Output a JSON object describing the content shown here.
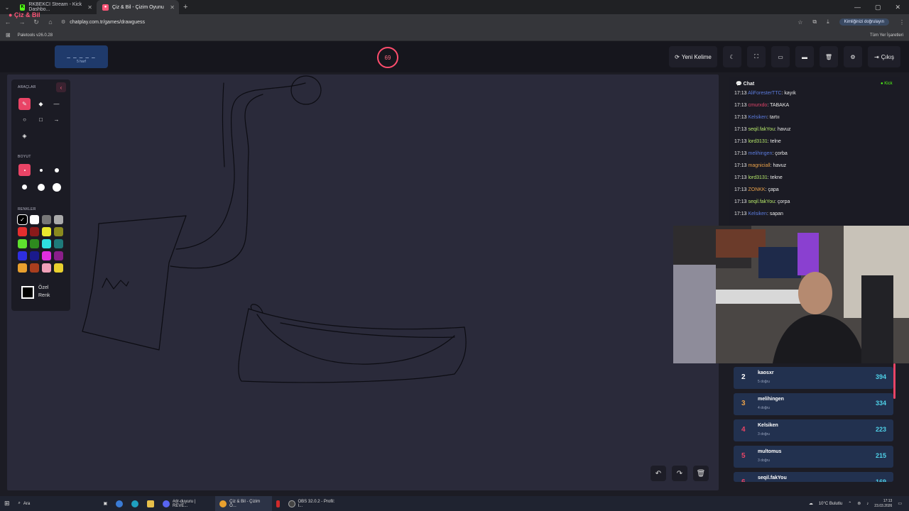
{
  "browser": {
    "tabs": [
      {
        "title": "RKBEKCI Stream - Kick Dashbo...",
        "icon": "kick-logo-icon",
        "color": "#53fc18"
      },
      {
        "title": "Çiz & Bil - Çizim Oyunu",
        "icon": "palette-icon",
        "color": "#ff5577"
      }
    ],
    "url": "chatplay.com.tr/games/drawguess",
    "verify_label": "Kimliğinizi doğrulayın",
    "bookmark": "Paletools v26.0.28",
    "all_bookmarks": "Tüm Yer İşaretleri"
  },
  "header": {
    "logo": "Çiz & Bil",
    "word_blanks": "_ _ _ _ _",
    "word_hint": "5 harf",
    "timer": "69",
    "new_word": "Yeni Kelime",
    "exit": "Çıkış"
  },
  "tools": {
    "section_tools": "ARAÇLAR",
    "section_size": "BOYUT",
    "section_colors": "RENKLER",
    "custom_color_line1": "Özel",
    "custom_color_line2": "Renk",
    "swatches": [
      "#000000",
      "#ffffff",
      "#777777",
      "#aaaaaa",
      "#e52e2e",
      "#8b1a1a",
      "#e8e82e",
      "#8a8a1e",
      "#5ee02e",
      "#2e8a1e",
      "#2ee0e0",
      "#1e7a7a",
      "#2e2ee0",
      "#1a1a8b",
      "#e02ee0",
      "#8a1e8a",
      "#e8a02e",
      "#a83e1e",
      "#f0a0b8",
      "#e8d02e"
    ]
  },
  "chat": {
    "title": "Chat",
    "source": "Kick",
    "messages": [
      {
        "time": "17:13",
        "user": "AliForesterTTC",
        "text": ": kayık",
        "color": "#5b7bdc"
      },
      {
        "time": "17:13",
        "user": "cmurxdo",
        "text": ": TABAKA",
        "color": "#e0446a"
      },
      {
        "time": "17:13",
        "user": "Kelsiken",
        "text": ": tartıı",
        "color": "#5b7bdc"
      },
      {
        "time": "17:13",
        "user": "seqil.fakYou",
        "text": ": havuz",
        "color": "#b6e86a"
      },
      {
        "time": "17:13",
        "user": "lord3131",
        "text": ": telne",
        "color": "#b6e86a"
      },
      {
        "time": "17:13",
        "user": "melihingen",
        "text": ": çorba",
        "color": "#5b7bdc"
      },
      {
        "time": "17:13",
        "user": "magniciall",
        "text": ": havuz",
        "color": "#e8a04a"
      },
      {
        "time": "17:13",
        "user": "lord3131",
        "text": ": tekne",
        "color": "#b6e86a"
      },
      {
        "time": "17:13",
        "user": "ZONKK",
        "text": ": çapa",
        "color": "#e8a04a"
      },
      {
        "time": "17:13",
        "user": "seqil.fakYou",
        "text": ": çorpa",
        "color": "#b6e86a"
      },
      {
        "time": "17:13",
        "user": "Kelsiken",
        "text": ": sapan",
        "color": "#5b7bdc"
      }
    ]
  },
  "leaderboard": [
    {
      "rank": "2",
      "name": "kaosxr",
      "sub": "5 doğru",
      "score": "394",
      "rank_color": "#ffffff"
    },
    {
      "rank": "3",
      "name": "melihingen",
      "sub": "4 doğru",
      "score": "334",
      "rank_color": "#e8a04a"
    },
    {
      "rank": "4",
      "name": "Kelsiken",
      "sub": "3 doğru",
      "score": "223",
      "rank_color": "#e94466"
    },
    {
      "rank": "5",
      "name": "multomus",
      "sub": "3 doğru",
      "score": "215",
      "rank_color": "#e94466"
    },
    {
      "rank": "6",
      "name": "seqil.fakYou",
      "sub": "",
      "score": "169",
      "rank_color": "#e94466"
    }
  ],
  "taskbar": {
    "search": "Ara",
    "apps": [
      {
        "label": "#dr-duyuru | REVE...",
        "color": "#5865f2"
      },
      {
        "label": "Çiz & Bil - Çizim O...",
        "color": "#e8a02e"
      },
      {
        "label": "OBS 32.0.2 - Profil: I...",
        "color": "#444"
      }
    ],
    "weather": "10°C  Bulutlu",
    "time": "17:13",
    "date": "23.03.2026"
  }
}
